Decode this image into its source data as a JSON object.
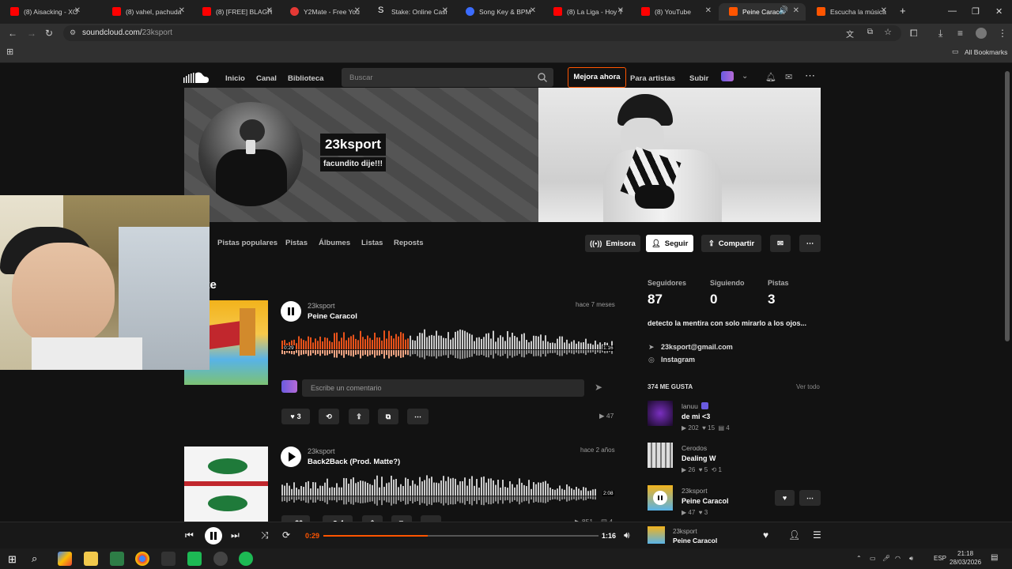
{
  "browser": {
    "tabs": [
      {
        "label": "(8) Aisacking - XO",
        "color": "#ff0000"
      },
      {
        "label": "(8) vahel, pachuda",
        "color": "#ff0000"
      },
      {
        "label": "(8) [FREE] BLAGH",
        "color": "#ff0000"
      },
      {
        "label": "Y2Mate - Free You",
        "color": "#e53935"
      },
      {
        "label": "Stake: Online Casi",
        "color": "#2f4553"
      },
      {
        "label": "Song Key & BPM",
        "color": "#3b6cff"
      },
      {
        "label": "(8) La Liga - Hoy T",
        "color": "#ff0000"
      },
      {
        "label": "(8) YouTube",
        "color": "#ff0000"
      },
      {
        "label": "Peine Caracol",
        "color": "#ff5500"
      },
      {
        "label": "Escucha la música",
        "color": "#ff5500"
      }
    ],
    "url_host": "soundcloud.com/",
    "url_path": "23ksport",
    "bookmarks_label": "All Bookmarks"
  },
  "header": {
    "nav": [
      "Inicio",
      "Canal",
      "Biblioteca"
    ],
    "search_placeholder": "Buscar",
    "upgrade": "Mejora ahora",
    "artists": "Para artistas",
    "upload": "Subir"
  },
  "profile": {
    "name": "23ksport",
    "subtitle": "facundito dije!!!",
    "tabs": [
      "Pistas populares",
      "Pistas",
      "Álbumes",
      "Listas",
      "Reposts"
    ],
    "station": "Emisora",
    "follow": "Seguir",
    "share": "Compartir",
    "section_title": "ente"
  },
  "tracks": [
    {
      "user": "23ksport",
      "title": "Peine Caracol",
      "ago": "hace 7 meses",
      "time_current": "0:29",
      "time_total": "1:16",
      "progress": 0.38,
      "likes": "3",
      "reposts": "",
      "plays": "47",
      "comment_placeholder": "Escribe un comentario"
    },
    {
      "user": "23ksport",
      "title": "Back2Back (Prod. Matte?)",
      "ago": "hace 2 años",
      "time_total": "2:08",
      "likes": "20",
      "reposts": "4",
      "plays": "851",
      "comments": "4"
    }
  ],
  "sidebar": {
    "stats": [
      {
        "label": "Seguidores",
        "value": "87"
      },
      {
        "label": "Siguiendo",
        "value": "0"
      },
      {
        "label": "Pistas",
        "value": "3"
      }
    ],
    "bio": "detecto la mentira con solo mirarlo a los ojos...",
    "email": "23ksport@gmail.com",
    "instagram": "Instagram",
    "likes_title": "374 ME GUSTA",
    "see_all": "Ver todo",
    "likes": [
      {
        "user": "lanuu",
        "title": "de mi <3",
        "plays": "202",
        "likes": "15",
        "comments": "4"
      },
      {
        "user": "Cerodos",
        "title": "Dealing W",
        "plays": "26",
        "likes": "5",
        "reposts": "1"
      },
      {
        "user": "23ksport",
        "title": "Peine Caracol",
        "plays": "47",
        "likes": "3"
      }
    ]
  },
  "player": {
    "current": "0:29",
    "total": "1:16",
    "progress": 0.38,
    "user": "23ksport",
    "title": "Peine Caracol"
  },
  "taskbar": {
    "lang": "ESP",
    "time": "21:18",
    "date": "28/03/2026"
  }
}
